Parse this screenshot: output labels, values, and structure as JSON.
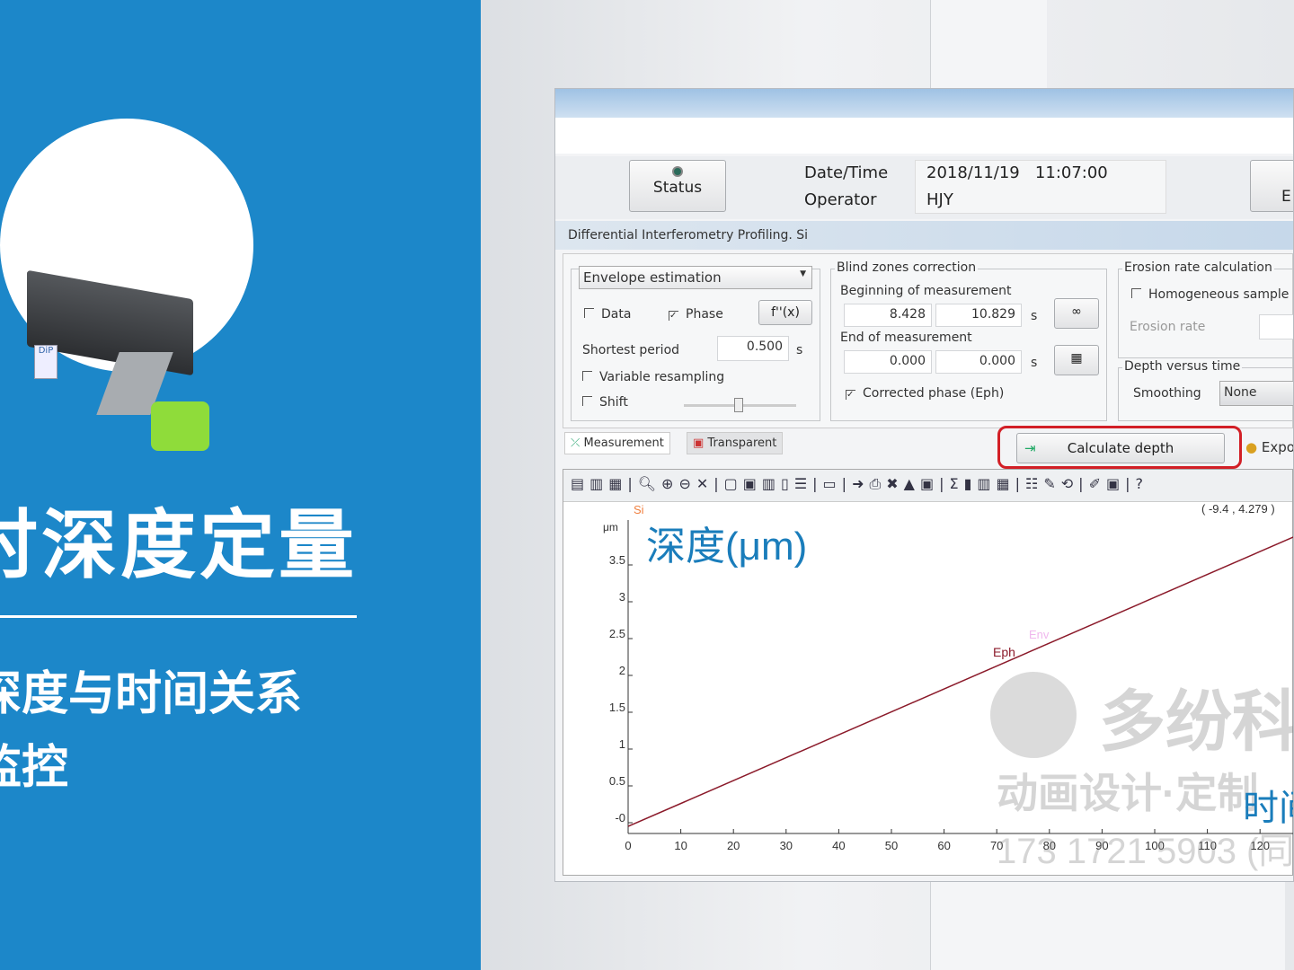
{
  "promo": {
    "title": "时深度定量",
    "line1": "深度与时间关系",
    "line2": "监控",
    "device_label": "DiP"
  },
  "header": {
    "status_label": "Status",
    "datetime_label": "Date/Time",
    "datetime_value": "2018/11/19   11:07:00",
    "operator_label": "Operator",
    "operator_value": "HJY",
    "right_button_partial": "E"
  },
  "subtitle": "Differential Interferometry Profiling. Si",
  "envelope": {
    "select_value": "Envelope estimation",
    "data_label": "Data",
    "data_checked": false,
    "phase_label": "Phase",
    "phase_checked": true,
    "fx_label": "f''(x)",
    "shortest_period_label": "Shortest period",
    "shortest_period_value": "0.500",
    "unit": "s",
    "variable_resampling_label": "Variable resampling",
    "shift_label": "Shift"
  },
  "blind": {
    "title": "Blind zones correction",
    "begin_label": "Beginning of measurement",
    "begin_from": "8.428",
    "begin_to": "10.829",
    "end_label": "End of measurement",
    "end_from": "0.000",
    "end_to": "0.000",
    "unit": "s",
    "corrected_label": "Corrected phase (Eph)",
    "corrected_checked": true
  },
  "erosion": {
    "title": "Erosion rate calculation",
    "homogeneous_label": "Homogeneous sample",
    "erosion_rate_label": "Erosion rate",
    "depth_time_title": "Depth versus time",
    "smoothing_label": "Smoothing",
    "smoothing_value": "None"
  },
  "tabs": [
    {
      "label": "Measurement"
    },
    {
      "label": "Transparent"
    }
  ],
  "calc_button": "Calculate depth",
  "export_button": "Expo",
  "chart_overlay": {
    "sample": "Si",
    "cursor": "( -9.4 , 4.279 )",
    "big_label": "深度(μm)",
    "time_label_partial": "时间"
  },
  "watermark": {
    "brand": "多纷科",
    "tagline": "动画设计·定制",
    "phone": "173 1721 5903 (同"
  },
  "chart_data": {
    "type": "line",
    "ylabel": "μm",
    "xlim": [
      0,
      128
    ],
    "ylim": [
      -0.1,
      4.1
    ],
    "xticks": [
      "0",
      "10",
      "20",
      "30",
      "40",
      "50",
      "60",
      "70",
      "80",
      "90",
      "100",
      "110",
      "120"
    ],
    "yticks": [
      "-0",
      "0.5",
      "1",
      "1.5",
      "2",
      "2.5",
      "3",
      "3.5"
    ],
    "series": [
      {
        "name": "Eph",
        "color": "#8b1a2a",
        "x": [
          0,
          127
        ],
        "y": [
          -0.05,
          3.9
        ]
      }
    ],
    "annotations": [
      "Eph",
      "Env"
    ],
    "grid": false
  }
}
